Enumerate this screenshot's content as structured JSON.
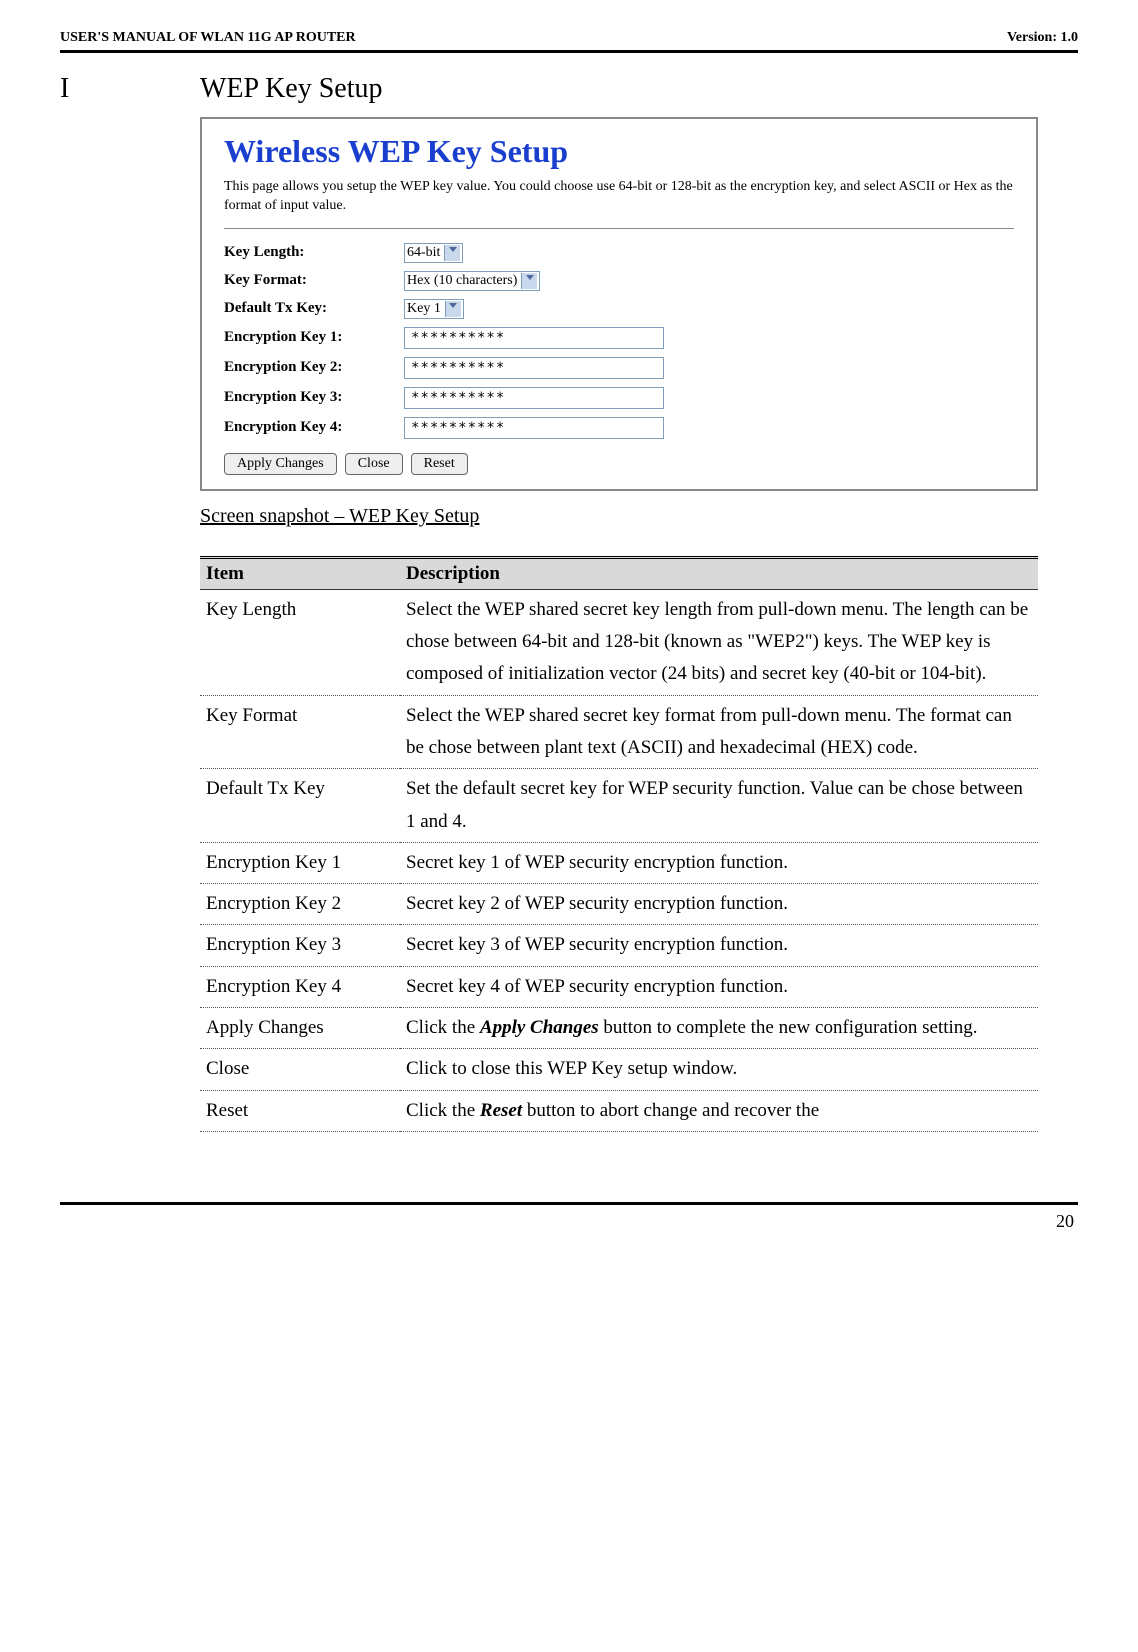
{
  "header": {
    "left": "USER'S MANUAL OF WLAN 11G AP ROUTER",
    "right": "Version: 1.0"
  },
  "section": {
    "letter": "I",
    "title": "WEP Key Setup"
  },
  "panel": {
    "title": "Wireless WEP Key Setup",
    "desc": "This page allows you setup the WEP key value. You could choose use 64-bit or 128-bit as the encryption key, and select ASCII or Hex as the format of input value.",
    "rows": {
      "key_length": {
        "label": "Key Length:",
        "value": "64-bit"
      },
      "key_format": {
        "label": "Key Format:",
        "value": "Hex (10 characters)"
      },
      "default_tx": {
        "label": "Default Tx Key:",
        "value": "Key 1"
      },
      "ek1": {
        "label": "Encryption Key 1:",
        "value": "**********"
      },
      "ek2": {
        "label": "Encryption Key 2:",
        "value": "**********"
      },
      "ek3": {
        "label": "Encryption Key 3:",
        "value": "**********"
      },
      "ek4": {
        "label": "Encryption Key 4:",
        "value": "**********"
      }
    },
    "buttons": {
      "apply": "Apply Changes",
      "close": "Close",
      "reset": "Reset"
    }
  },
  "caption": "Screen snapshot – WEP Key Setup",
  "table": {
    "head": {
      "item": "Item",
      "desc": "Description"
    },
    "rows": [
      {
        "item": "Key Length",
        "desc": "Select the WEP shared secret key length from pull-down menu. The length can be chose between 64-bit and 128-bit (known as \"WEP2\") keys.\nThe WEP key is composed of initialization vector (24 bits) and secret key (40-bit or 104-bit)."
      },
      {
        "item": "Key Format",
        "desc": "Select the WEP shared secret key format from pull-down menu. The format can be chose between plant text (ASCII) and hexadecimal (HEX) code."
      },
      {
        "item": "Default Tx Key",
        "desc": "Set the default secret key for WEP security function. Value can be chose between 1 and 4."
      },
      {
        "item": "Encryption Key 1",
        "desc": "Secret key 1 of WEP security encryption function."
      },
      {
        "item": "Encryption Key 2",
        "desc": "Secret key 2 of WEP security encryption function."
      },
      {
        "item": "Encryption Key 3",
        "desc": "Secret key 3 of WEP security encryption function."
      },
      {
        "item": "Encryption Key 4",
        "desc": "Secret key 4 of WEP security encryption function."
      },
      {
        "item": "Apply Changes",
        "desc_html": "Click the <em class='b'>Apply Changes</em> button to complete the new configuration setting."
      },
      {
        "item": "Close",
        "desc": "Click to close this WEP Key setup window."
      },
      {
        "item": "Reset",
        "desc_html": "Click the <em class='b'>Reset</em> button to abort change and recover the"
      }
    ]
  },
  "page_num": "20"
}
